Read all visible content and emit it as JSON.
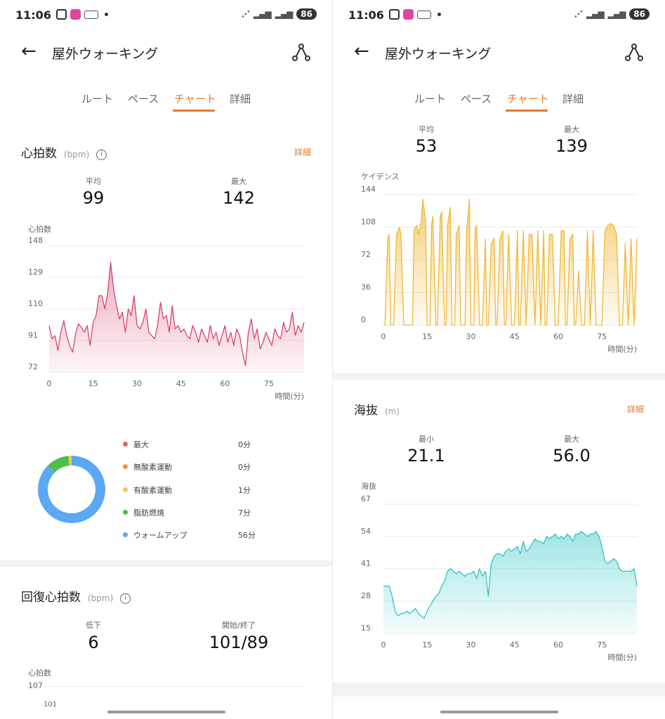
{
  "status_bar": {
    "time": "11:06",
    "battery": "86",
    "wifi_label": "WIFI"
  },
  "app_bar": {
    "title": "屋外ウォーキング"
  },
  "tabs": [
    {
      "label": "ルート",
      "active": false
    },
    {
      "label": "ペース",
      "active": false
    },
    {
      "label": "チャート",
      "active": true
    },
    {
      "label": "詳細",
      "active": false
    }
  ],
  "heart_rate": {
    "title": "心拍数",
    "unit": "(bpm)",
    "detail_link": "詳細",
    "avg_label": "平均",
    "avg_value": "99",
    "max_label": "最大",
    "max_value": "142",
    "chart_ylabel": "心拍数",
    "chart_xlabel": "時間(分)",
    "chart_yticks": [
      "148",
      "129",
      "110",
      "91",
      "72"
    ],
    "chart_xticks": [
      "0",
      "15",
      "30",
      "45",
      "60",
      "75"
    ]
  },
  "zones": [
    {
      "name": "最大",
      "value": "0分",
      "color": "#e8605c",
      "minutes": 0
    },
    {
      "name": "無酸素運動",
      "value": "0分",
      "color": "#f0904a",
      "minutes": 0
    },
    {
      "name": "有酸素運動",
      "value": "1分",
      "color": "#f2c94c",
      "minutes": 1
    },
    {
      "name": "脂肪燃焼",
      "value": "7分",
      "color": "#4cbf4c",
      "minutes": 7
    },
    {
      "name": "ウォームアップ",
      "value": "56分",
      "color": "#5aa9f2",
      "minutes": 56
    }
  ],
  "recovery": {
    "title": "回復心拍数",
    "unit": "(bpm)",
    "drop_label": "低下",
    "drop_value": "6",
    "startend_label": "開始/終了",
    "startend_value": "101/89",
    "chart_ylabel": "心拍数",
    "chart_ytick_top": "107",
    "chart_ytick_next": "101"
  },
  "cadence": {
    "avg_label": "平均",
    "avg_value": "53",
    "max_label": "最大",
    "max_value": "139",
    "chart_ylabel": "ケイデンス",
    "chart_xlabel": "時間(分)",
    "chart_yticks": [
      "144",
      "108",
      "72",
      "36",
      "0"
    ],
    "chart_xticks": [
      "0",
      "15",
      "30",
      "45",
      "60",
      "75"
    ]
  },
  "altitude": {
    "title": "海抜",
    "unit": "(m)",
    "detail_link": "詳細",
    "min_label": "最小",
    "min_value": "21.1",
    "max_label": "最大",
    "max_value": "56.0",
    "chart_ylabel": "海抜",
    "chart_xlabel": "時間(分)",
    "chart_yticks": [
      "67",
      "54",
      "41",
      "28",
      "15"
    ],
    "chart_xticks": [
      "0",
      "15",
      "30",
      "45",
      "60",
      "75"
    ]
  },
  "colors": {
    "accent": "#e8762c",
    "heart": "#d9456a",
    "cadence": "#f0b93a",
    "altitude": "#2fc4c4"
  },
  "chart_data": [
    {
      "type": "line",
      "ylabel": "心拍数",
      "xlabel": "時間(分)",
      "ylim": [
        72,
        148
      ],
      "xlim": [
        0,
        87
      ],
      "series": [
        {
          "x": [
            0,
            1,
            2,
            3,
            4,
            5,
            6,
            7,
            8,
            9,
            10,
            11,
            12,
            13,
            14,
            15,
            16,
            17,
            18,
            19,
            20,
            21,
            22,
            23,
            24,
            25,
            26,
            27,
            28,
            29,
            30,
            31,
            32,
            33,
            34,
            35,
            36,
            37,
            38,
            39,
            40,
            41,
            42,
            43,
            44,
            45,
            46,
            47,
            48,
            49,
            50,
            51,
            52,
            53,
            54,
            55,
            56,
            57,
            58,
            59,
            60,
            61,
            62,
            63,
            64,
            65,
            66,
            67,
            68,
            69,
            70,
            71,
            72,
            73,
            74,
            75,
            76,
            77,
            78,
            79,
            80,
            81,
            82,
            83,
            84,
            85,
            86,
            87
          ],
          "y": [
            100,
            92,
            94,
            85,
            96,
            103,
            94,
            88,
            84,
            95,
            101,
            99,
            96,
            100,
            88,
            102,
            106,
            118,
            118,
            110,
            120,
            138,
            122,
            112,
            104,
            108,
            96,
            110,
            106,
            118,
            100,
            98,
            102,
            110,
            96,
            94,
            92,
            100,
            114,
            104,
            106,
            96,
            112,
            98,
            100,
            96,
            98,
            94,
            92,
            100,
            96,
            90,
            98,
            94,
            90,
            100,
            92,
            96,
            88,
            94,
            100,
            90,
            96,
            88,
            98,
            94,
            84,
            76,
            96,
            104,
            92,
            98,
            86,
            90,
            96,
            92,
            88,
            98,
            94,
            92,
            102,
            96,
            98,
            108,
            94,
            100,
            96,
            102
          ]
        }
      ]
    },
    {
      "type": "pie",
      "categories": [
        "最大",
        "無酸素運動",
        "有酸素運動",
        "脂肪燃焼",
        "ウォームアップ"
      ],
      "values": [
        0,
        0,
        1,
        7,
        56
      ]
    },
    {
      "type": "area",
      "ylabel": "ケイデンス",
      "xlabel": "時間(分)",
      "ylim": [
        0,
        144
      ],
      "xlim": [
        0,
        87
      ],
      "series": [
        {
          "x": [
            0,
            0.5,
            1.5,
            2,
            2.5,
            3.5,
            4.5,
            5.5,
            6,
            7,
            10,
            10.5,
            11.5,
            12,
            13,
            13.5,
            14.5,
            15,
            16,
            16.5,
            17,
            18,
            18.5,
            19.5,
            20,
            21,
            21.5,
            22,
            23,
            23.5,
            24.5,
            25,
            26,
            26.5,
            28,
            28.5,
            29.5,
            30,
            31,
            31.5,
            32,
            33,
            33.5,
            34,
            35,
            35.5,
            36,
            37,
            38,
            38.5,
            39,
            40,
            41,
            41.5,
            42,
            43,
            44,
            45,
            46,
            46.5,
            47,
            48,
            49,
            50,
            51,
            52,
            53,
            54,
            55,
            55.5,
            56,
            57,
            58,
            59,
            60,
            61,
            62,
            62.5,
            63,
            64,
            65,
            65.5,
            66,
            67,
            68,
            69,
            70,
            71,
            72,
            73,
            74,
            75,
            76,
            77,
            78,
            79,
            80,
            81,
            82,
            83,
            84,
            85,
            86,
            87
          ],
          "y": [
            0,
            0,
            95,
            100,
            0,
            0,
            100,
            108,
            100,
            0,
            0,
            105,
            110,
            100,
            115,
            139,
            115,
            0,
            0,
            110,
            120,
            0,
            0,
            120,
            125,
            0,
            0,
            110,
            130,
            0,
            0,
            100,
            110,
            0,
            0,
            100,
            139,
            0,
            0,
            105,
            110,
            0,
            0,
            0,
            95,
            0,
            0,
            90,
            96,
            0,
            0,
            95,
            104,
            0,
            0,
            100,
            0,
            0,
            104,
            0,
            0,
            104,
            0,
            100,
            100,
            0,
            104,
            0,
            104,
            0,
            0,
            100,
            100,
            0,
            0,
            104,
            104,
            0,
            0,
            95,
            100,
            0,
            0,
            60,
            0,
            0,
            104,
            0,
            104,
            0,
            0,
            0,
            104,
            110,
            112,
            110,
            100,
            0,
            0,
            90,
            0,
            95,
            0,
            96
          ]
        }
      ]
    },
    {
      "type": "area",
      "ylabel": "海抜",
      "xlabel": "時間(分)",
      "ylim": [
        15,
        67
      ],
      "xlim": [
        0,
        87
      ],
      "series": [
        {
          "x": [
            0,
            1,
            2,
            3,
            4,
            5,
            6,
            7,
            8,
            9,
            10,
            11,
            12,
            13,
            14,
            15,
            16,
            17,
            18,
            19,
            20,
            21,
            22,
            23,
            24,
            25,
            26,
            27,
            28,
            29,
            30,
            31,
            32,
            33,
            34,
            35,
            36,
            37,
            38,
            39,
            40,
            41,
            42,
            43,
            44,
            45,
            46,
            47,
            48,
            49,
            50,
            51,
            52,
            53,
            54,
            55,
            56,
            57,
            58,
            59,
            60,
            61,
            62,
            63,
            64,
            65,
            66,
            67,
            68,
            69,
            70,
            71,
            72,
            73,
            74,
            75,
            76,
            77,
            78,
            79,
            80,
            81,
            82,
            83,
            84,
            85,
            86,
            87
          ],
          "y": [
            34,
            34,
            34,
            30,
            24,
            22,
            23,
            23,
            24,
            23,
            24,
            25,
            23,
            22,
            21,
            24,
            26,
            28,
            30,
            31,
            34,
            36,
            40,
            41,
            40,
            39,
            40,
            39,
            38,
            39,
            39,
            40,
            37,
            41,
            38,
            40,
            30,
            43,
            46,
            47,
            47,
            46,
            48,
            49,
            48,
            49,
            50,
            47,
            52,
            48,
            49,
            51,
            53,
            52,
            52,
            51,
            54,
            53,
            54,
            55,
            53,
            54,
            53,
            55,
            54,
            52,
            55,
            55,
            56,
            55,
            54,
            55,
            55,
            56,
            54,
            50,
            44,
            43,
            44,
            45,
            44,
            41,
            40,
            40,
            40,
            40,
            41,
            34
          ]
        }
      ]
    }
  ]
}
